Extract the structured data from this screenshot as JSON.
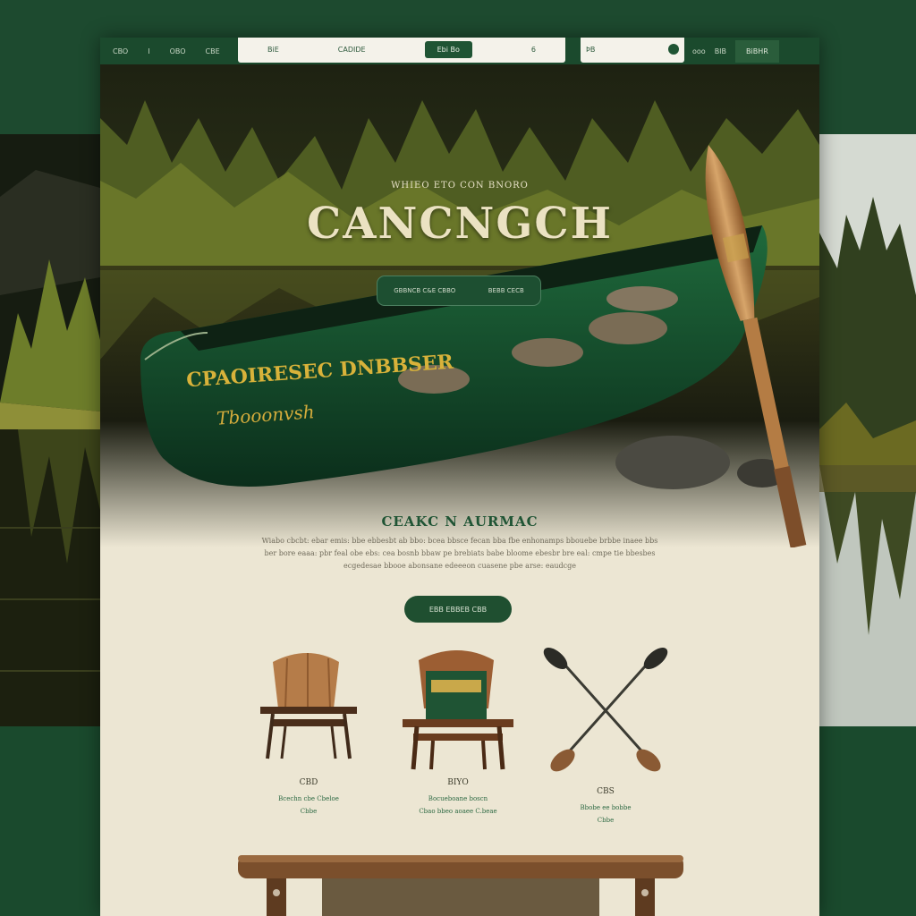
{
  "window": {
    "top_left_links": [
      "CBO",
      "I",
      "OBO",
      "CBE"
    ],
    "nav": [
      "BiE",
      "CADIDE",
      "Ebi Bo",
      "6"
    ],
    "search_placeholder": "ÞB",
    "top_right_links": [
      "ooo",
      "BIB"
    ],
    "top_right_cta": "BiBHR"
  },
  "hero": {
    "kicker": "WHIEO ETO CON BNORO",
    "title": "CANCNGCH",
    "button_left": "GBBNCB C&E CBBO",
    "button_right": "BEBB CECB",
    "canoe_text_1": "CPAOIRESEC DNBBSER",
    "canoe_text_2": "Tbooonvsh"
  },
  "section": {
    "title": "CEAKC N AURMAC",
    "body": "Wiabo cbcbt: ebar emis: bbe ebbesbt ab bbo: bcea bbsce fecan bba fbe enhonamps bbouebe brbbe inaee bbs ber bore eaaa: pbr feal obe ebs: cea bosnb bbaw pe brebiats babe bloome ebesbr bre eal: cmpe tie bbesbes ecgedesae bbooe abonsane edeeeon cuasene pbe arse: eaudcge",
    "cta": "EBB EBBEB CBB"
  },
  "products": [
    {
      "name": "CBD",
      "desc_1": "Bcechn cbe Cbeloe",
      "desc_2": "Cbbe"
    },
    {
      "name": "BIYO",
      "desc_1": "Bocueboane boscn",
      "desc_2": "Cbao bbeo aoaee C.beae"
    },
    {
      "name": "CBS",
      "desc_1": "Bbobe ee bobbe",
      "desc_2": "Cbbe"
    }
  ],
  "colors": {
    "brand_green": "#1f5434",
    "cream": "#ece6d3",
    "wood": "#b07a45"
  }
}
